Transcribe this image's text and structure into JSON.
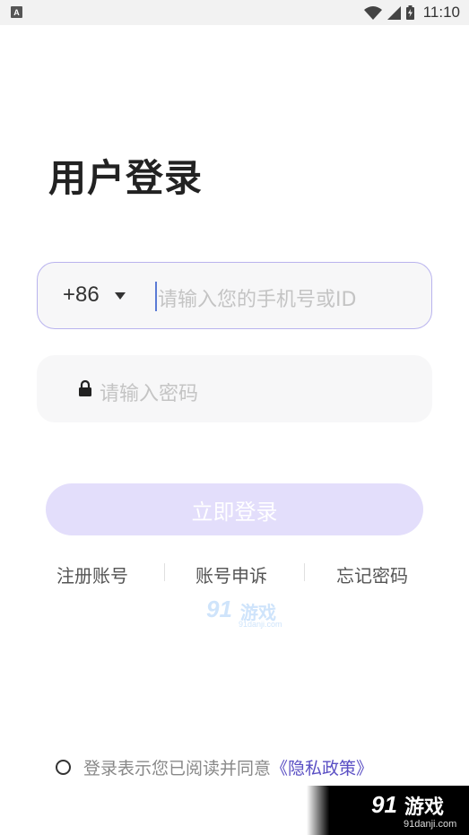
{
  "status_bar": {
    "app_icon_letter": "A",
    "time": "11:10",
    "icons": [
      "wifi-icon",
      "cell-signal-icon",
      "battery-icon"
    ]
  },
  "title": "用户登录",
  "phone": {
    "country_code": "+86",
    "placeholder": "请输入您的手机号或ID"
  },
  "password": {
    "placeholder": "请输入密码"
  },
  "login_button": "立即登录",
  "links": {
    "register": "注册账号",
    "appeal": "账号申诉",
    "forgot": "忘记密码"
  },
  "agreement": {
    "text": "登录表示您已阅读并同意",
    "privacy": "《隐私政策》"
  },
  "watermark": {
    "logo_num": "91",
    "logo_text": "游戏",
    "url": "91danji.com"
  },
  "colors": {
    "accent_border": "#b9b3ee",
    "button_bg": "#e3defb",
    "privacy_link": "#5a4fc4"
  }
}
